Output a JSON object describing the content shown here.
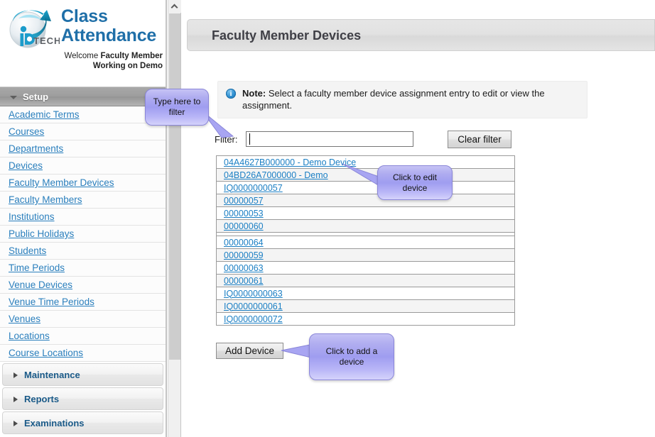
{
  "brand": {
    "logo_icon": "globe-swoosh-logo",
    "title_line1": "Class",
    "title_line2": "Attendance",
    "welcome_lead": "Welcome ",
    "welcome_role": "Faculty Member",
    "working_on": "Working on Demo"
  },
  "sidebar": {
    "setup": {
      "label": "Setup",
      "expanded": true,
      "items": [
        {
          "label": "Academic Terms"
        },
        {
          "label": "Courses"
        },
        {
          "label": "Departments"
        },
        {
          "label": "Devices"
        },
        {
          "label": "Faculty Member Devices"
        },
        {
          "label": "Faculty Members"
        },
        {
          "label": "Institutions"
        },
        {
          "label": "Public Holidays"
        },
        {
          "label": "Students"
        },
        {
          "label": "Time Periods"
        },
        {
          "label": "Venue Devices"
        },
        {
          "label": "Venue Time Periods"
        },
        {
          "label": "Venues"
        },
        {
          "label": "Locations"
        },
        {
          "label": "Course Locations"
        }
      ]
    },
    "collapsed_sections": [
      {
        "label": "Maintenance"
      },
      {
        "label": "Reports"
      },
      {
        "label": "Examinations"
      }
    ]
  },
  "scrollbar": {
    "up_arrow_icon": "chevron-up-icon"
  },
  "header": {
    "title": "Faculty Member Devices"
  },
  "note": {
    "icon": "info-icon",
    "label": "Note:",
    "text": " Select a faculty member device assignment entry to edit or view the assignment."
  },
  "filter": {
    "label": "Filter:",
    "value": "",
    "placeholder": "",
    "clear_label": "Clear filter"
  },
  "devices": [
    {
      "label": "04A4627B000000 - Demo Device",
      "spacer": false
    },
    {
      "label": "04BD26A7000000 - Demo",
      "spacer": false
    },
    {
      "label": "IQ0000000057",
      "spacer": false
    },
    {
      "label": "00000057",
      "spacer": false
    },
    {
      "label": "00000053",
      "spacer": false
    },
    {
      "label": "00000060",
      "spacer": false
    },
    {
      "label": "",
      "spacer": true
    },
    {
      "label": "00000064",
      "spacer": false
    },
    {
      "label": "00000059",
      "spacer": false
    },
    {
      "label": "00000063",
      "spacer": false
    },
    {
      "label": "00000061",
      "spacer": false
    },
    {
      "label": "IQ0000000063",
      "spacer": false
    },
    {
      "label": "IQ0000000061",
      "spacer": false
    },
    {
      "label": "IQ0000000072",
      "spacer": false
    }
  ],
  "add_device": {
    "label": "Add Device"
  },
  "callouts": {
    "filter": "Type here to filter",
    "edit": "Click to edit device",
    "add": "Click to add a device"
  },
  "colors": {
    "brand_blue": "#1f6fa8",
    "link_blue": "#2a7fbd",
    "device_link_blue": "#1b7fc4",
    "callout_purple": "#9f9df0",
    "header_gray": "#e2e2e2"
  }
}
